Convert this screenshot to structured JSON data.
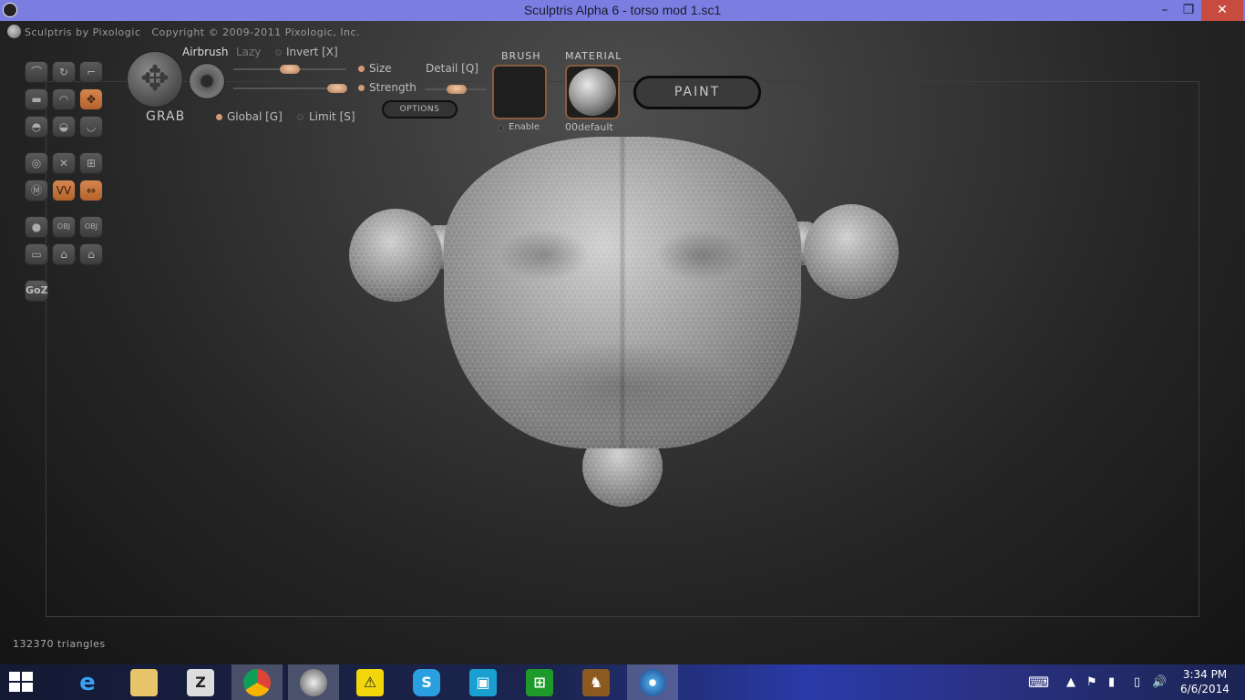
{
  "window": {
    "title": "Sculptris Alpha 6 - torso mod 1.sc1",
    "controls": {
      "minimize": "–",
      "restore": "❐",
      "close": "✕"
    }
  },
  "app": {
    "brand": "Sculptris by Pixologic",
    "copyright": "Copyright © 2009-2011 Pixologic, Inc."
  },
  "tool": {
    "current_tool_label": "GRAB",
    "brush_mode": "Airbrush",
    "lazy_label": "Lazy",
    "invert_label": "Invert [X]",
    "size_label": "Size",
    "strength_label": "Strength",
    "detail_label": "Detail [Q]",
    "global_label": "Global [G]",
    "limit_label": "Limit [S]",
    "options_label": "OPTIONS",
    "size_value": 0.5,
    "strength_value": 0.92,
    "detail_value": 0.35
  },
  "brush_panel": {
    "heading": "BRUSH",
    "enable_label": "Enable"
  },
  "material_panel": {
    "heading": "MATERIAL",
    "name": "00default"
  },
  "paint_button": "PAINT",
  "status": {
    "triangles": "132370 triangles"
  },
  "toolbar": {
    "goz_label": "GoZ"
  },
  "taskbar": {
    "time": "3:34 PM",
    "date": "6/6/2014",
    "apps": [
      "internet-explorer",
      "file-explorer",
      "zbrush",
      "chrome",
      "sculptris",
      "warning-app",
      "skype",
      "photo-app",
      "store",
      "game",
      "disc-app"
    ]
  },
  "colors": {
    "titlebar": "#7b7ee0",
    "accent_orange": "#c8743c",
    "close_red": "#c74b3f"
  }
}
